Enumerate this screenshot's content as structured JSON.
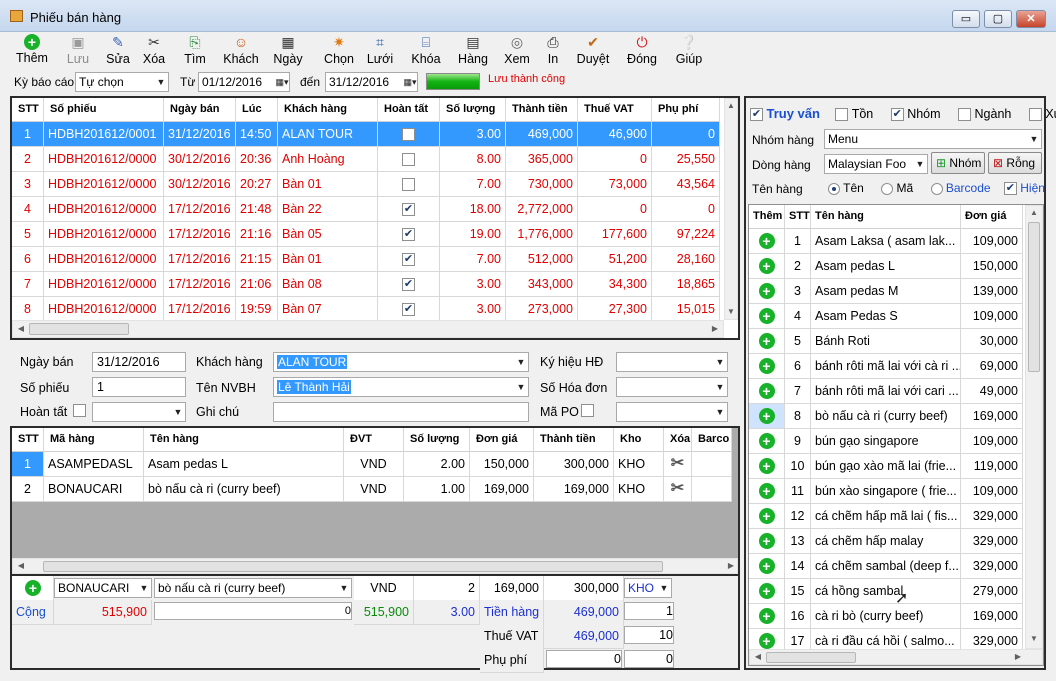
{
  "window": {
    "title": "Phiếu bán hàng",
    "min": "▭",
    "max": "▢",
    "close": "✕"
  },
  "toolbar": [
    {
      "label": "Thêm",
      "icon": "add-icon",
      "glyph": "+",
      "color": "#17b12a",
      "disabled": false
    },
    {
      "label": "Lưu",
      "icon": "save-icon",
      "glyph": "▣",
      "color": "#9a9a9a",
      "disabled": true
    },
    {
      "label": "Sửa",
      "icon": "edit-icon",
      "glyph": "✎",
      "color": "#3a62b5",
      "disabled": false
    },
    {
      "label": "Xóa",
      "icon": "delete-icon",
      "glyph": "✂",
      "color": "#333333",
      "disabled": false
    },
    {
      "label": "Tìm",
      "icon": "find-icon",
      "glyph": "⎘",
      "color": "#2a8a3a",
      "disabled": false
    },
    {
      "label": "Khách",
      "icon": "customer-icon",
      "glyph": "☺",
      "color": "#c25a12",
      "disabled": false
    },
    {
      "label": "Ngày",
      "icon": "calendar-icon",
      "glyph": "▦",
      "color": "#333333",
      "disabled": false
    },
    {
      "label": "Chọn",
      "icon": "select-icon",
      "glyph": "✷",
      "color": "#e07a10",
      "disabled": false
    },
    {
      "label": "Lưới",
      "icon": "grid-icon",
      "glyph": "⌗",
      "color": "#2d5fa8",
      "disabled": false
    },
    {
      "label": "Khóa",
      "icon": "lock-icon",
      "glyph": "⌸",
      "color": "#2d5fa8",
      "disabled": false
    },
    {
      "label": "Hàng",
      "icon": "goods-icon",
      "glyph": "▤",
      "color": "#333333",
      "disabled": false
    },
    {
      "label": "Xem",
      "icon": "preview-icon",
      "glyph": "◎",
      "color": "#666666",
      "disabled": false
    },
    {
      "label": "In",
      "icon": "print-icon",
      "glyph": "⎙",
      "color": "#222222",
      "disabled": false
    },
    {
      "label": "Duyệt",
      "icon": "approve-icon",
      "glyph": "✔",
      "color": "#c06a14",
      "disabled": false
    },
    {
      "label": "Đóng",
      "icon": "power-icon",
      "glyph": "⏻",
      "color": "#d11a1a",
      "disabled": false
    },
    {
      "label": "Giúp",
      "icon": "help-icon",
      "glyph": "❔",
      "color": "#2a6fc2",
      "disabled": false
    }
  ],
  "filter": {
    "period_label": "Kỳ báo cáo",
    "period_value": "Tự chọn",
    "from_label": "Từ",
    "from_value": "01/12/2016",
    "to_label": "đến",
    "to_value": "31/12/2016",
    "status": "Lưu thành công"
  },
  "invoices": {
    "columns": [
      "STT",
      "Số phiếu",
      "Ngày bán",
      "Lúc",
      "Khách hàng",
      "Hoàn tất",
      "Số lượng",
      "Thành tiền",
      "Thuế VAT",
      "Phụ phí"
    ],
    "rows": [
      {
        "stt": "1",
        "so_phieu": "HDBH201612/0001",
        "ngay": "31/12/2016",
        "luc": "14:50",
        "khach": "ALAN TOUR",
        "hoan_tat": false,
        "sl": "3.00",
        "thanh_tien": "469,000",
        "vat": "46,900",
        "phu_phi": "0"
      },
      {
        "stt": "2",
        "so_phieu": "HDBH201612/0000",
        "ngay": "30/12/2016",
        "luc": "20:36",
        "khach": "Anh Hoàng",
        "hoan_tat": false,
        "sl": "8.00",
        "thanh_tien": "365,000",
        "vat": "0",
        "phu_phi": "25,550"
      },
      {
        "stt": "3",
        "so_phieu": "HDBH201612/0000",
        "ngay": "30/12/2016",
        "luc": "20:27",
        "khach": "Bàn 01",
        "hoan_tat": false,
        "sl": "7.00",
        "thanh_tien": "730,000",
        "vat": "73,000",
        "phu_phi": "43,564"
      },
      {
        "stt": "4",
        "so_phieu": "HDBH201612/0000",
        "ngay": "17/12/2016",
        "luc": "21:48",
        "khach": "Bàn 22",
        "hoan_tat": true,
        "sl": "18.00",
        "thanh_tien": "2,772,000",
        "vat": "0",
        "phu_phi": "0"
      },
      {
        "stt": "5",
        "so_phieu": "HDBH201612/0000",
        "ngay": "17/12/2016",
        "luc": "21:16",
        "khach": "Bàn 05",
        "hoan_tat": true,
        "sl": "19.00",
        "thanh_tien": "1,776,000",
        "vat": "177,600",
        "phu_phi": "97,224"
      },
      {
        "stt": "6",
        "so_phieu": "HDBH201612/0000",
        "ngay": "17/12/2016",
        "luc": "21:15",
        "khach": "Bàn 01",
        "hoan_tat": true,
        "sl": "7.00",
        "thanh_tien": "512,000",
        "vat": "51,200",
        "phu_phi": "28,160"
      },
      {
        "stt": "7",
        "so_phieu": "HDBH201612/0000",
        "ngay": "17/12/2016",
        "luc": "21:06",
        "khach": "Bàn 08",
        "hoan_tat": true,
        "sl": "3.00",
        "thanh_tien": "343,000",
        "vat": "34,300",
        "phu_phi": "18,865"
      },
      {
        "stt": "8",
        "so_phieu": "HDBH201612/0000",
        "ngay": "17/12/2016",
        "luc": "19:59",
        "khach": "Bàn 07",
        "hoan_tat": true,
        "sl": "3.00",
        "thanh_tien": "273,000",
        "vat": "27,300",
        "phu_phi": "15,015"
      }
    ]
  },
  "form": {
    "ngay_ban_label": "Ngày bán",
    "ngay_ban": "31/12/2016",
    "khach_hang_label": "Khách hàng",
    "khach_hang": "ALAN TOUR",
    "ky_hieu_label": "Ký hiệu HĐ",
    "ky_hieu": "",
    "so_phieu_label": "Số phiếu",
    "so_phieu": "1",
    "nvbh_label": "Tên NVBH",
    "nvbh": "Lê Thành Hải",
    "so_hoa_don_label": "Số Hóa đơn",
    "so_hoa_don": "",
    "hoan_tat_label": "Hoàn tất",
    "hoan_tat_value": "",
    "ghi_chu_label": "Ghi chú",
    "ghi_chu": "",
    "ma_po_label": "Mã PO",
    "ma_po": ""
  },
  "details": {
    "columns": [
      "STT",
      "Mã hàng",
      "Tên hàng",
      "ĐVT",
      "Số lượng",
      "Đơn giá",
      "Thành tiền",
      "Kho",
      "Xóa",
      "Barco"
    ],
    "rows": [
      {
        "stt": "1",
        "ma": "ASAMPEDASL",
        "ten": "Asam pedas L",
        "dvt": "VND",
        "sl": "2.00",
        "don_gia": "150,000",
        "thanh_tien": "300,000",
        "kho": "KHO"
      },
      {
        "stt": "2",
        "ma": "BONAUCARI",
        "ten": "bò nấu cà ri (curry beef)",
        "dvt": "VND",
        "sl": "1.00",
        "don_gia": "169,000",
        "thanh_tien": "169,000",
        "kho": "KHO"
      }
    ]
  },
  "entry": {
    "ma": "BONAUCARI",
    "ten": "bò nấu cà ri (curry beef)",
    "dvt": "VND",
    "sl": "2",
    "don_gia": "169,000",
    "thanh_tien": "300,000",
    "kho": "KHO"
  },
  "totals": {
    "cong_label": "Cộng",
    "cong": "515,900",
    "note": "0",
    "cong2": "515,900",
    "sl": "3.00",
    "tien_hang_label": "Tiền hàng",
    "tien_hang": "469,000",
    "tien_hang_x": "1",
    "vat_label": "Thuế VAT",
    "vat": "469,000",
    "vat_x": "10",
    "phu_phi_label": "Phụ phí",
    "phu_phi": "0",
    "phu_phi_x": "0"
  },
  "search": {
    "truy_van": "Truy vấn",
    "ton": "Tồn",
    "nhom": "Nhóm",
    "nganh": "Ngành",
    "xuat": "Xuấ",
    "nhom_hang_label": "Nhóm hàng",
    "nhom_hang": "Menu",
    "dong_hang_label": "Dòng hàng",
    "dong_hang": "Malaysian Foo",
    "nhom_btn": "Nhóm",
    "rong_btn": "Rỗng",
    "ten_hang_label": "Tên hàng",
    "opt_ten": "Tên",
    "opt_ma": "Mã",
    "opt_barcode": "Barcode",
    "hien": "Hiện"
  },
  "products": {
    "columns": [
      "Thêm",
      "STT",
      "Tên hàng",
      "Đơn giá"
    ],
    "rows": [
      {
        "stt": "1",
        "ten": "Asam Laksa ( asam lak...",
        "gia": "109,000"
      },
      {
        "stt": "2",
        "ten": "Asam pedas L",
        "gia": "150,000"
      },
      {
        "stt": "3",
        "ten": "Asam pedas M",
        "gia": "139,000"
      },
      {
        "stt": "4",
        "ten": "Asam Pedas S",
        "gia": "109,000"
      },
      {
        "stt": "5",
        "ten": "Bánh Roti",
        "gia": "30,000"
      },
      {
        "stt": "6",
        "ten": "bánh rôti mã lai với cà ri ...",
        "gia": "69,000"
      },
      {
        "stt": "7",
        "ten": "bánh rôti mã lai với cari ...",
        "gia": "49,000"
      },
      {
        "stt": "8",
        "ten": "bò nấu cà ri (curry beef)",
        "gia": "169,000"
      },
      {
        "stt": "9",
        "ten": "bún gạo singapore",
        "gia": "109,000"
      },
      {
        "stt": "10",
        "ten": "bún gạo xào mã lai (frie...",
        "gia": "119,000"
      },
      {
        "stt": "11",
        "ten": "bún xào singapore ( frie...",
        "gia": "109,000"
      },
      {
        "stt": "12",
        "ten": "cá chẽm hấp mã lai ( fis...",
        "gia": "329,000"
      },
      {
        "stt": "13",
        "ten": "cá chẽm hấp malay",
        "gia": "329,000"
      },
      {
        "stt": "14",
        "ten": "cá chẽm sambal (deep f...",
        "gia": "329,000"
      },
      {
        "stt": "15",
        "ten": "cá hồng sambal",
        "gia": "279,000"
      },
      {
        "stt": "16",
        "ten": "cà ri bò (curry beef)",
        "gia": "169,000"
      },
      {
        "stt": "17",
        "ten": "cà ri đầu cá hồi ( salmo...",
        "gia": "329,000"
      }
    ]
  }
}
